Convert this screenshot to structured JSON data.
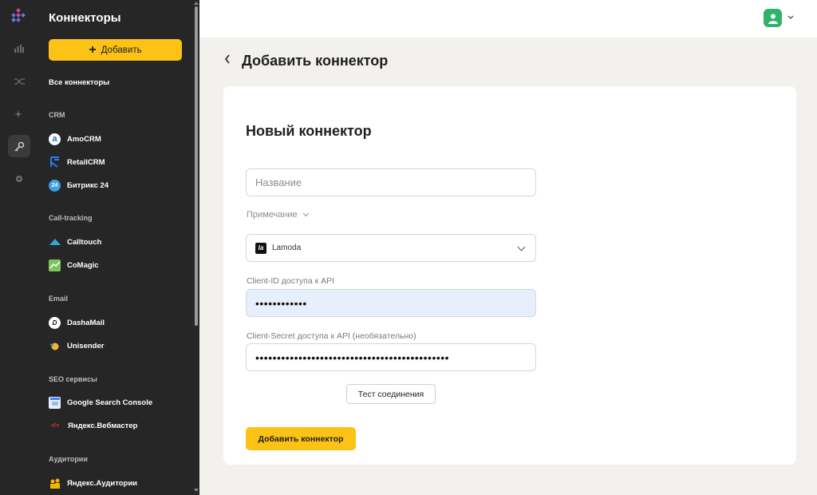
{
  "sidebar": {
    "title": "Коннекторы",
    "add_label": "Добавить",
    "all_connectors": "Все коннекторы",
    "sections": [
      {
        "title": "CRM",
        "items": [
          {
            "label": "AmoCRM",
            "icon": "amocrm-icon"
          },
          {
            "label": "RetailCRM",
            "icon": "retailcrm-icon"
          },
          {
            "label": "Битрикс 24",
            "icon": "bitrix24-icon",
            "badge": "24"
          }
        ]
      },
      {
        "title": "Call-tracking",
        "items": [
          {
            "label": "Calltouch",
            "icon": "calltouch-icon"
          },
          {
            "label": "CoMagic",
            "icon": "comagic-icon"
          }
        ]
      },
      {
        "title": "Email",
        "items": [
          {
            "label": "DashaMail",
            "icon": "dashamail-icon",
            "badge": "D"
          },
          {
            "label": "Unisender",
            "icon": "unisender-icon"
          }
        ]
      },
      {
        "title": "SEO сервисы",
        "items": [
          {
            "label": "Google Search Console",
            "icon": "google-search-console-icon"
          },
          {
            "label": "Яндекс.Вебмастер",
            "icon": "yandex-webmaster-icon",
            "badge": "</>"
          }
        ]
      },
      {
        "title": "Аудитории",
        "items": [
          {
            "label": "Яндекс.Аудитории",
            "icon": "yandex-audiences-icon"
          }
        ]
      }
    ]
  },
  "rail": [
    "dashboard-icon",
    "shuffle-icon",
    "sparkle-icon",
    "key-icon",
    "settings-icon"
  ],
  "header": {
    "back_icon": "back-arrow-icon",
    "title": "Добавить коннектор"
  },
  "form": {
    "title": "Новый коннектор",
    "name_placeholder": "Название",
    "note_label": "Примечание",
    "source_selected": "Lamoda",
    "source_logo": "la",
    "client_id_label": "Client-ID доступа к API",
    "client_id_value": "••••••••••••",
    "client_secret_label": "Client-Secret доступа к API (необязательно)",
    "client_secret_value": "•••••••••••••••••••••••••••••••••••••••••••••",
    "test_button": "Тест соединения",
    "submit_button": "Добавить коннектор"
  },
  "colors": {
    "accent": "#fcc316",
    "sidebar_bg": "#262626",
    "avatar": "#2fb36a"
  }
}
